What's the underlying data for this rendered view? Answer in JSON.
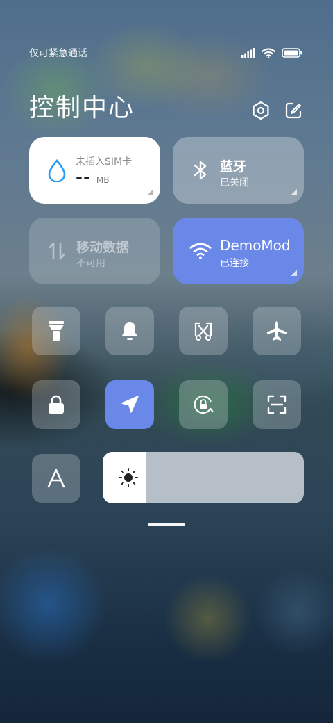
{
  "status_bar": {
    "carrier_text": "仅可紧急通话",
    "signal_icon": "signal-icon",
    "wifi_icon": "wifi-icon",
    "battery_icon": "battery-icon"
  },
  "header": {
    "title": "控制中心",
    "settings_icon": "settings-hexagon-icon",
    "edit_icon": "edit-icon"
  },
  "cards": {
    "data_usage": {
      "label": "未插入SIM卡",
      "value": "--",
      "unit": "MB",
      "icon": "water-drop-icon",
      "bg": "#ffffff"
    },
    "bluetooth": {
      "label": "蓝牙",
      "status": "已关闭",
      "icon": "bluetooth-icon"
    },
    "mobile_data": {
      "label": "移动数据",
      "status": "不可用",
      "icon": "data-transfer-icon"
    },
    "wlan": {
      "label": "DemoMod",
      "status": "已连接",
      "icon": "wifi-icon",
      "bg": "#6a88e8"
    }
  },
  "toggles": [
    {
      "name": "flashlight",
      "icon": "flashlight-icon",
      "active": false
    },
    {
      "name": "silent",
      "icon": "bell-icon",
      "active": false
    },
    {
      "name": "screenshot",
      "icon": "scissors-icon",
      "active": false
    },
    {
      "name": "airplane-mode",
      "icon": "airplane-icon",
      "active": false
    },
    {
      "name": "lock-screen",
      "icon": "lock-icon",
      "active": false
    },
    {
      "name": "location",
      "icon": "location-arrow-icon",
      "active": true
    },
    {
      "name": "rotation-lock",
      "icon": "rotation-lock-icon",
      "active": false
    },
    {
      "name": "scanner",
      "icon": "scan-icon",
      "active": false
    },
    {
      "name": "font-size",
      "icon": "font-a-icon",
      "active": false
    }
  ],
  "brightness": {
    "level": 0.1,
    "icon": "sun-icon"
  },
  "colors": {
    "accent": "#6a88e8",
    "tile_bg": "rgba(215,222,228,0.28)"
  }
}
